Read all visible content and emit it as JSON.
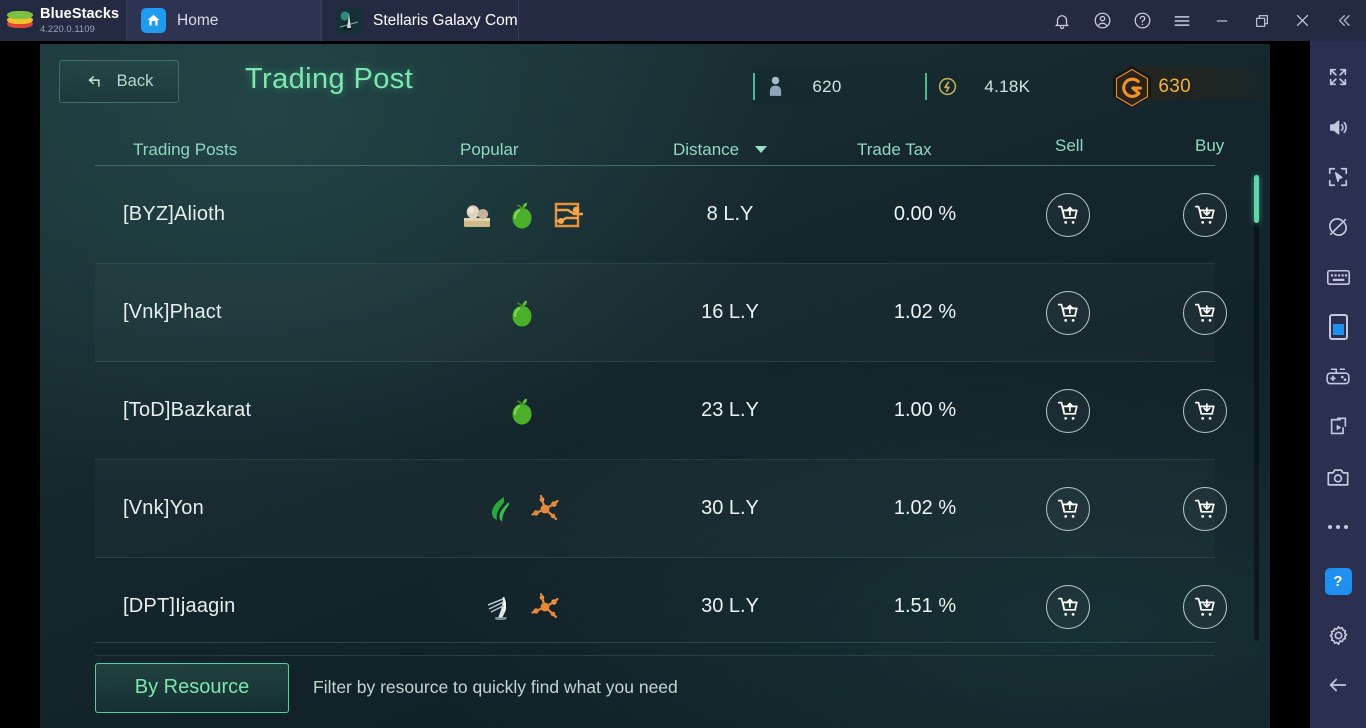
{
  "titlebar": {
    "brand_name": "BlueStacks",
    "brand_version": "4.220.0.1109",
    "tabs": [
      {
        "label": "Home",
        "icon": "home-icon",
        "active": true
      },
      {
        "label": "Stellaris  Galaxy Com",
        "icon": "game-icon",
        "active": false
      }
    ],
    "controls": [
      {
        "name": "notifications-icon",
        "glyph": "bell"
      },
      {
        "name": "account-icon",
        "glyph": "account"
      },
      {
        "name": "help-icon",
        "glyph": "question"
      },
      {
        "name": "menu-icon",
        "glyph": "hamburger"
      },
      {
        "name": "minimize-button",
        "glyph": "minimize"
      },
      {
        "name": "maximize-button",
        "glyph": "restore"
      },
      {
        "name": "close-button",
        "glyph": "close"
      },
      {
        "name": "collapse-sidebar-button",
        "glyph": "double-chevron-left"
      }
    ]
  },
  "sidebar": {
    "items": [
      {
        "name": "fullscreen-icon",
        "label": "Fullscreen"
      },
      {
        "name": "volume-icon",
        "label": "Volume"
      },
      {
        "name": "cursor-capture-icon",
        "label": "Cursor capture"
      },
      {
        "name": "rotate-lock-icon",
        "label": "Rotate lock"
      },
      {
        "name": "keyboard-controls-icon",
        "label": "Keyboard controls"
      },
      {
        "name": "phone-mode-icon",
        "label": "Phone mode"
      },
      {
        "name": "gamepad-icon",
        "label": "Gamepad controls"
      },
      {
        "name": "screen-record-icon",
        "label": "Record screen"
      },
      {
        "name": "screenshot-icon",
        "label": "Screenshot"
      },
      {
        "name": "more-options-icon",
        "label": "More"
      },
      {
        "name": "help-button",
        "label": "?"
      },
      {
        "name": "settings-gear-icon",
        "label": "Settings"
      },
      {
        "name": "back-arrow-icon",
        "label": "Back"
      }
    ]
  },
  "game": {
    "back_label": "Back",
    "page_title": "Trading Post",
    "resources": [
      {
        "name": "population",
        "icon": "person-icon",
        "value": "620"
      },
      {
        "name": "energy",
        "icon": "energy-icon",
        "value": "4.18K"
      },
      {
        "name": "premium-currency",
        "icon": "gold-hex-icon",
        "value": "630"
      }
    ],
    "columns": {
      "name": "Trading Posts",
      "popular": "Popular",
      "distance": "Distance",
      "trade_tax": "Trade Tax",
      "sell": "Sell",
      "buy": "Buy"
    },
    "sort": {
      "column": "Distance",
      "direction": "desc"
    },
    "rows": [
      {
        "name": "[BYZ]Alioth",
        "resources": [
          "ore-icon",
          "fruit-icon",
          "alloy-icon"
        ],
        "distance": "8 L.Y",
        "trade_tax": "0.00 %",
        "sell_label": "Sell",
        "buy_label": "Buy"
      },
      {
        "name": "[Vnk]Phact",
        "resources": [
          "fruit-icon"
        ],
        "distance": "16 L.Y",
        "trade_tax": "1.02 %",
        "sell_label": "Sell",
        "buy_label": "Buy"
      },
      {
        "name": "[ToD]Bazkarat",
        "resources": [
          "fruit-icon"
        ],
        "distance": "23 L.Y",
        "trade_tax": "1.00 %",
        "sell_label": "Sell",
        "buy_label": "Buy"
      },
      {
        "name": "[Vnk]Yon",
        "resources": [
          "leaf-icon",
          "alloy-icon"
        ],
        "distance": "30 L.Y",
        "trade_tax": "1.02 %",
        "sell_label": "Sell",
        "buy_label": "Buy"
      },
      {
        "name": "[DPT]Ijaagin",
        "resources": [
          "crystal-icon",
          "alloy-icon"
        ],
        "distance": "30 L.Y",
        "trade_tax": "1.51 %",
        "sell_label": "Sell",
        "buy_label": "Buy"
      }
    ],
    "footer": {
      "filter_button": "By Resource",
      "hint": "Filter by resource to quickly find what you need"
    }
  },
  "colors": {
    "accent_green": "#7ee6b0",
    "gold": "#f2b33c",
    "panel_bg": "#14262c",
    "titlebar_bg": "#252a43",
    "sidebar_bg": "#2b3050",
    "blue_accent": "#1f8ff0"
  }
}
